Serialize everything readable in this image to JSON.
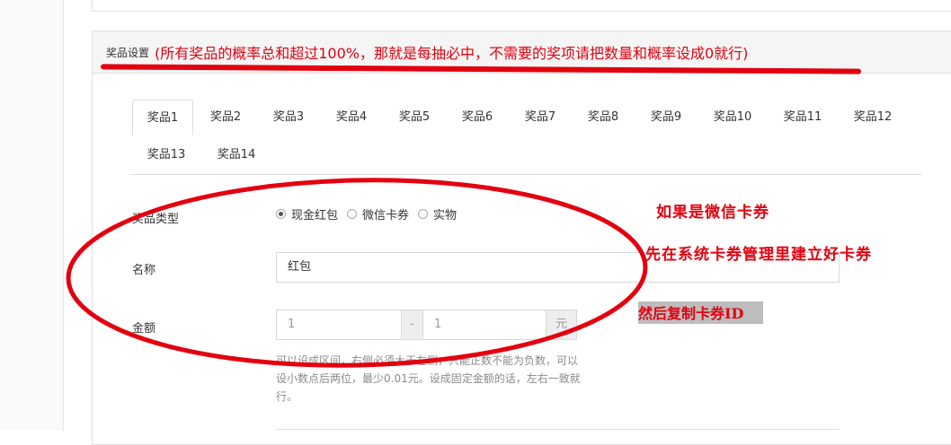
{
  "panel": {
    "title": "奖品设置",
    "note": "(所有奖品的概率总和超过100%，那就是每抽必中，不需要的奖项请把数量和概率设成0就行)"
  },
  "tabs": [
    "奖品1",
    "奖品2",
    "奖品3",
    "奖品4",
    "奖品5",
    "奖品6",
    "奖品7",
    "奖品8",
    "奖品9",
    "奖品10",
    "奖品11",
    "奖品12",
    "奖品13",
    "奖品14"
  ],
  "form": {
    "type_label": "奖品类型",
    "type_options": [
      "现金红包",
      "微信卡券",
      "实物"
    ],
    "type_selected": "现金红包",
    "name_label": "名称",
    "name_value": "红包",
    "amount_label": "金额",
    "amount_min": "1",
    "amount_sep": "-",
    "amount_max": "1",
    "amount_unit": "元",
    "help": "可以设成区间，右侧必须大于左侧，只能正数不能为负数，可以设小数点后两位，最少0.01元。设成固定金额的话，左右一致就行。"
  },
  "annotations": {
    "line1": "如果是微信卡券",
    "line2": "先在系统卡券管理里建立好卡券",
    "line3": "然后复制卡券ID"
  },
  "colors": {
    "annotation_red": "#e3000f",
    "border": "#e1e1e1"
  }
}
